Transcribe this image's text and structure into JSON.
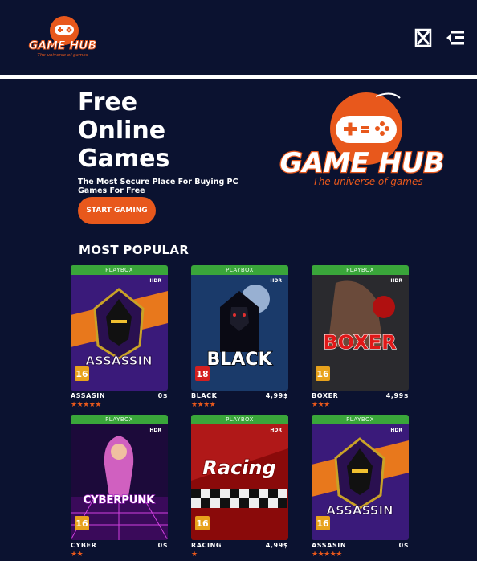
{
  "header": {
    "logo": {
      "title": "GAME HUB",
      "tagline": "The universe of games"
    },
    "icons": [
      "close-x-icon",
      "menu-icon"
    ]
  },
  "hero": {
    "title_lines": [
      "Free",
      "Online",
      "Games"
    ],
    "subtitle": "The Most Secure Place For Buying PC Games For Free",
    "cta_label": "START GAMING",
    "logo": {
      "title": "GAME HUB",
      "tagline": "The universe of games"
    }
  },
  "section": {
    "title": "MOST POPULAR"
  },
  "cards": [
    {
      "platform": "PLAYBOX",
      "hdr": "HDR",
      "cover_title": "ASSASSIN",
      "age": "16",
      "name": "ASSASIN",
      "price": "0$",
      "stars": "★★★★★",
      "rating": 5
    },
    {
      "platform": "PLAYBOX",
      "hdr": "HDR",
      "cover_title": "BLACK",
      "age": "18",
      "name": "BLACK",
      "price": "4,99$",
      "stars": "★★★★",
      "rating": 4
    },
    {
      "platform": "PLAYBOX",
      "hdr": "HDR",
      "cover_title": "BOXER",
      "age": "16",
      "name": "BOXER",
      "price": "4,99$",
      "stars": "★★★",
      "rating": 3
    },
    {
      "platform": "PLAYBOX",
      "hdr": "HDR",
      "cover_title": "CYBERPUNK",
      "age": "16",
      "name": "CYBER",
      "price": "0$",
      "stars": "★★",
      "rating": 2
    },
    {
      "platform": "PLAYBOX",
      "hdr": "HDR",
      "cover_title": "Racing",
      "age": "16",
      "name": "RACING",
      "price": "4,99$",
      "stars": "★",
      "rating": 1
    },
    {
      "platform": "PLAYBOX",
      "hdr": "HDR",
      "cover_title": "ASSASSIN",
      "age": "16",
      "name": "ASSASIN",
      "price": "0$",
      "stars": "★★★★★",
      "rating": 5
    }
  ],
  "colors": {
    "background": "#0b1230",
    "accent": "#e8581c",
    "platform_bar": "#3aa63a",
    "white": "#ffffff"
  }
}
